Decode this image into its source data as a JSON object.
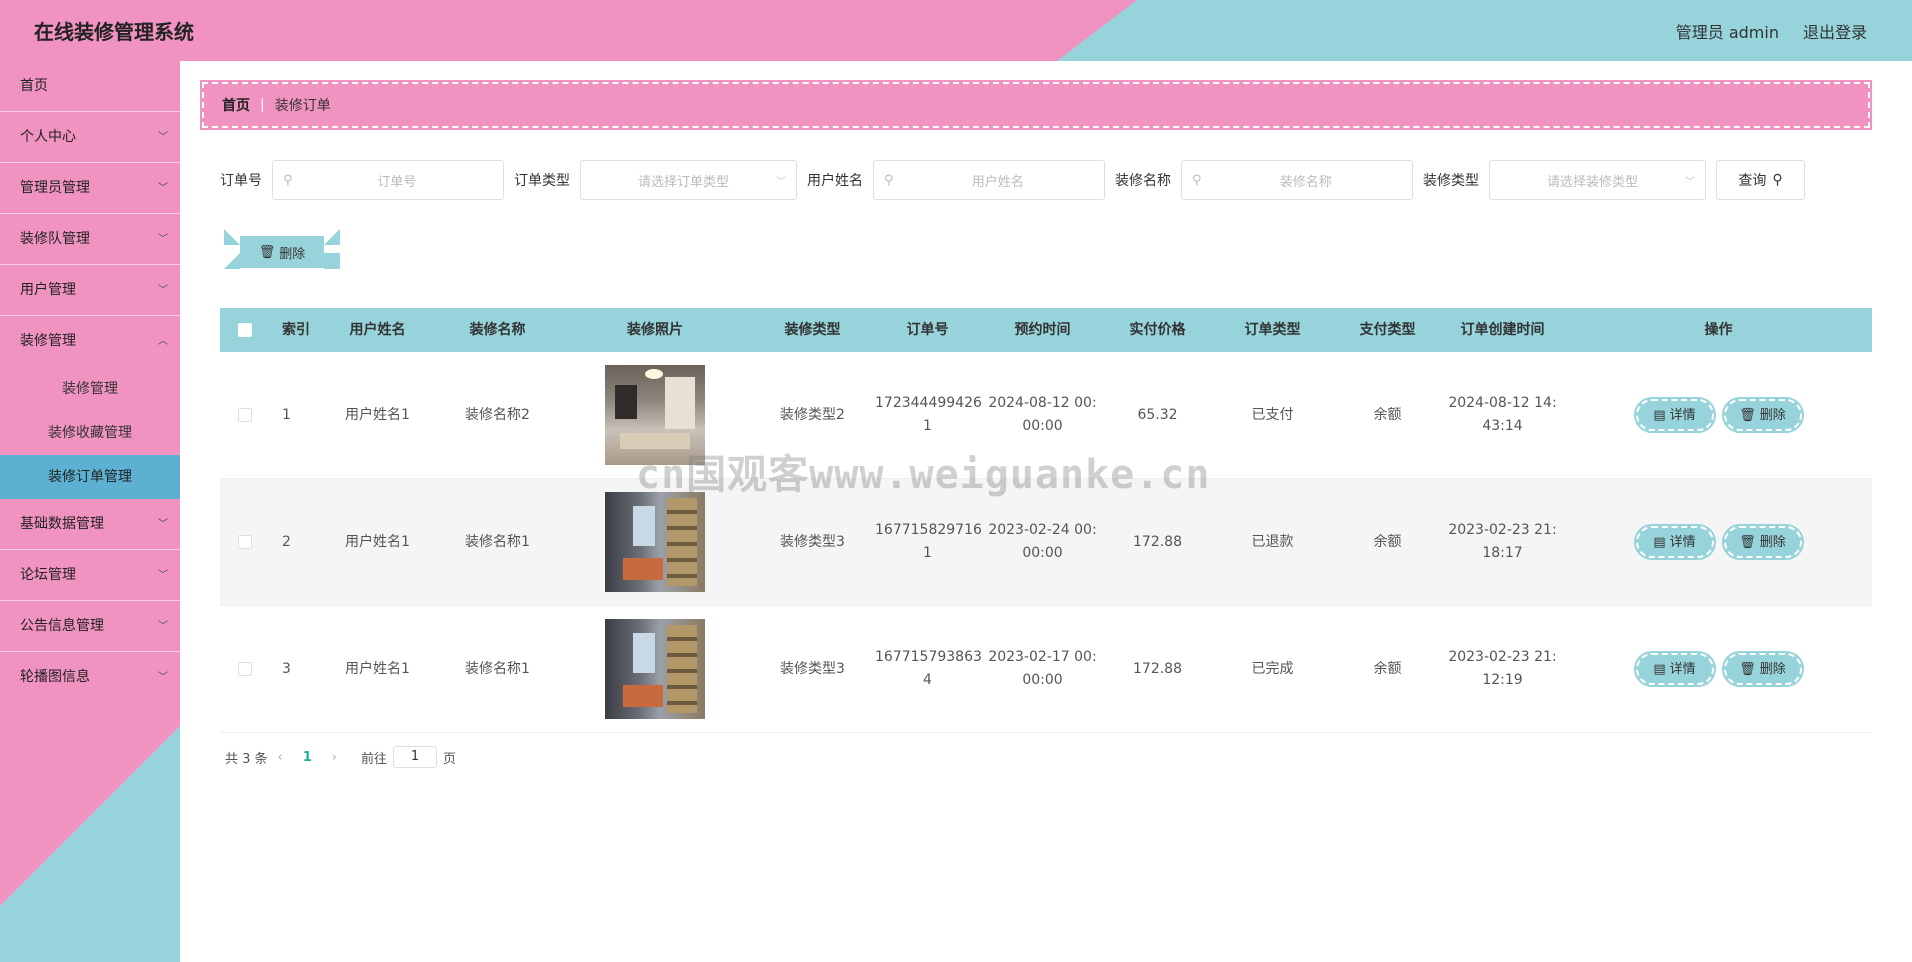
{
  "header": {
    "title": "在线装修管理系统",
    "user_label": "管理员 admin",
    "logout_label": "退出登录"
  },
  "sidebar": {
    "items": [
      {
        "label": "首页",
        "has_arrow": false
      },
      {
        "label": "个人中心",
        "has_arrow": true
      },
      {
        "label": "管理员管理",
        "has_arrow": true
      },
      {
        "label": "装修队管理",
        "has_arrow": true
      },
      {
        "label": "用户管理",
        "has_arrow": true
      },
      {
        "label": "装修管理",
        "has_arrow": true,
        "expanded": true
      }
    ],
    "sub_items": [
      {
        "label": "装修管理"
      },
      {
        "label": "装修收藏管理"
      },
      {
        "label": "装修订单管理",
        "active": true
      }
    ],
    "items_after": [
      {
        "label": "基础数据管理"
      },
      {
        "label": "论坛管理"
      },
      {
        "label": "公告信息管理"
      },
      {
        "label": "轮播图信息"
      }
    ]
  },
  "breadcrumb": {
    "home": "首页",
    "current": "装修订单"
  },
  "search": {
    "order_no_label": "订单号",
    "order_no_placeholder": "订单号",
    "order_type_label": "订单类型",
    "order_type_placeholder": "请选择订单类型",
    "user_name_label": "用户姓名",
    "user_name_placeholder": "用户姓名",
    "deco_name_label": "装修名称",
    "deco_name_placeholder": "装修名称",
    "deco_type_label": "装修类型",
    "deco_type_placeholder": "请选择装修类型",
    "query_label": "查询"
  },
  "toolbar": {
    "delete_label": "删除"
  },
  "table": {
    "headers": {
      "index": "索引",
      "user": "用户姓名",
      "name": "装修名称",
      "photo": "装修照片",
      "type": "装修类型",
      "order": "订单号",
      "time": "预约时间",
      "price": "实付价格",
      "otype": "订单类型",
      "pay": "支付类型",
      "ctime": "订单创建时间",
      "ops": "操作"
    },
    "rows": [
      {
        "index": "1",
        "user": "用户姓名1",
        "name": "装修名称2",
        "type": "装修类型2",
        "order_a": "172344499426",
        "order_b": "1",
        "time_a": "2024-08-12 00:",
        "time_b": "00:00",
        "price": "65.32",
        "otype": "已支付",
        "pay": "余额",
        "ctime_a": "2024-08-12 14:",
        "ctime_b": "43:14"
      },
      {
        "index": "2",
        "user": "用户姓名1",
        "name": "装修名称1",
        "type": "装修类型3",
        "order_a": "167715829716",
        "order_b": "1",
        "time_a": "2023-02-24 00:",
        "time_b": "00:00",
        "price": "172.88",
        "otype": "已退款",
        "pay": "余额",
        "ctime_a": "2023-02-23 21:",
        "ctime_b": "18:17"
      },
      {
        "index": "3",
        "user": "用户姓名1",
        "name": "装修名称1",
        "type": "装修类型3",
        "order_a": "167715793863",
        "order_b": "4",
        "time_a": "2023-02-17 00:",
        "time_b": "00:00",
        "price": "172.88",
        "otype": "已完成",
        "pay": "余额",
        "ctime_a": "2023-02-23 21:",
        "ctime_b": "12:19"
      }
    ],
    "detail_label": "详情",
    "delete_label": "删除"
  },
  "pager": {
    "total": "共 3 条",
    "current": "1",
    "goto_prefix": "前往",
    "goto_value": "1",
    "goto_suffix": "页"
  },
  "watermark": "cn国观客www.weiguanke.cn",
  "colors": {
    "pink": "#f193c1",
    "teal": "#96d3da",
    "active_blue": "#5cb1d2",
    "pager_active": "#19b394"
  }
}
